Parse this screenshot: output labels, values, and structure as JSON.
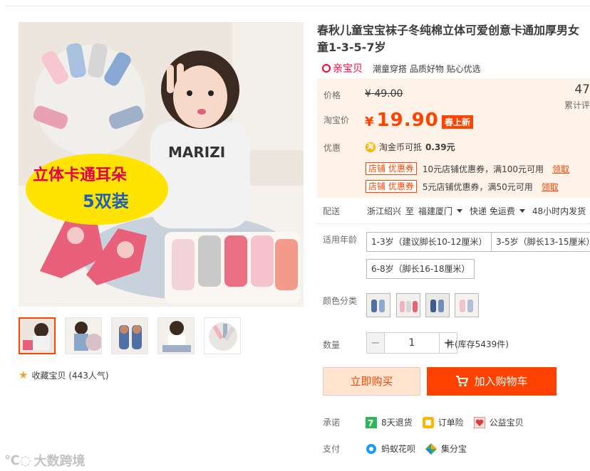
{
  "product": {
    "title": "春秋儿童宝宝袜子冬纯棉立体可爱创意卡通加厚男女童1-3-5-7岁",
    "promo_text": "立体卡通耳朵",
    "promo_count": "5双装"
  },
  "favorite": {
    "label": "收藏宝贝 (443人气)"
  },
  "tags": {
    "brand": "亲宝贝",
    "text": "潮童穿搭 品质好物 贴心优选"
  },
  "price": {
    "orig_label": "价格",
    "orig_value": "¥ 49.00",
    "taobao_label": "淘宝价",
    "currency": "¥",
    "taobao_value": "19.90",
    "new_badge": "春上新",
    "sales_count": "47",
    "sales_label": "累计评"
  },
  "discount": {
    "label": "优惠",
    "coin_text": "淘金币可抵",
    "coin_value": "0.39元",
    "coupons": [
      {
        "tag": "店铺 优惠券",
        "text": "10元店铺优惠券，满100元可用",
        "action": "领取"
      },
      {
        "tag": "店铺 优惠券",
        "text": "5元店铺优惠券，满50元可用",
        "action": "领取"
      }
    ]
  },
  "delivery": {
    "label": "配送",
    "from": "浙江绍兴",
    "to_word": "至",
    "dest": "福建厦门",
    "shipping": "快递 免运费",
    "timing": "48小时内发货"
  },
  "age": {
    "label": "适用年龄",
    "options": [
      "1-3岁（建议脚长10-12厘米）",
      "3-5岁（脚长13-15厘米）",
      "6-8岁（脚长16-18厘米）"
    ]
  },
  "color": {
    "label": "颜色分类",
    "options": [
      "color-1",
      "color-2",
      "color-3",
      "color-4"
    ]
  },
  "quantity": {
    "label": "数量",
    "value": "1",
    "minus": "−",
    "plus": "+",
    "stock": "件(库存5439件)"
  },
  "actions": {
    "buy": "立即购买",
    "cart": "加入购物车"
  },
  "promise": {
    "label": "承诺",
    "items": [
      "8天退货",
      "订单险",
      "公益宝贝"
    ]
  },
  "payment": {
    "label": "支付",
    "items": [
      "蚂蚁花呗",
      "集分宝"
    ]
  },
  "watermark": {
    "text": "大数跨境"
  },
  "colors": {
    "accent": "#ff4400",
    "price_bg": "#fff2e8",
    "cart_btn": "#ff4200"
  }
}
